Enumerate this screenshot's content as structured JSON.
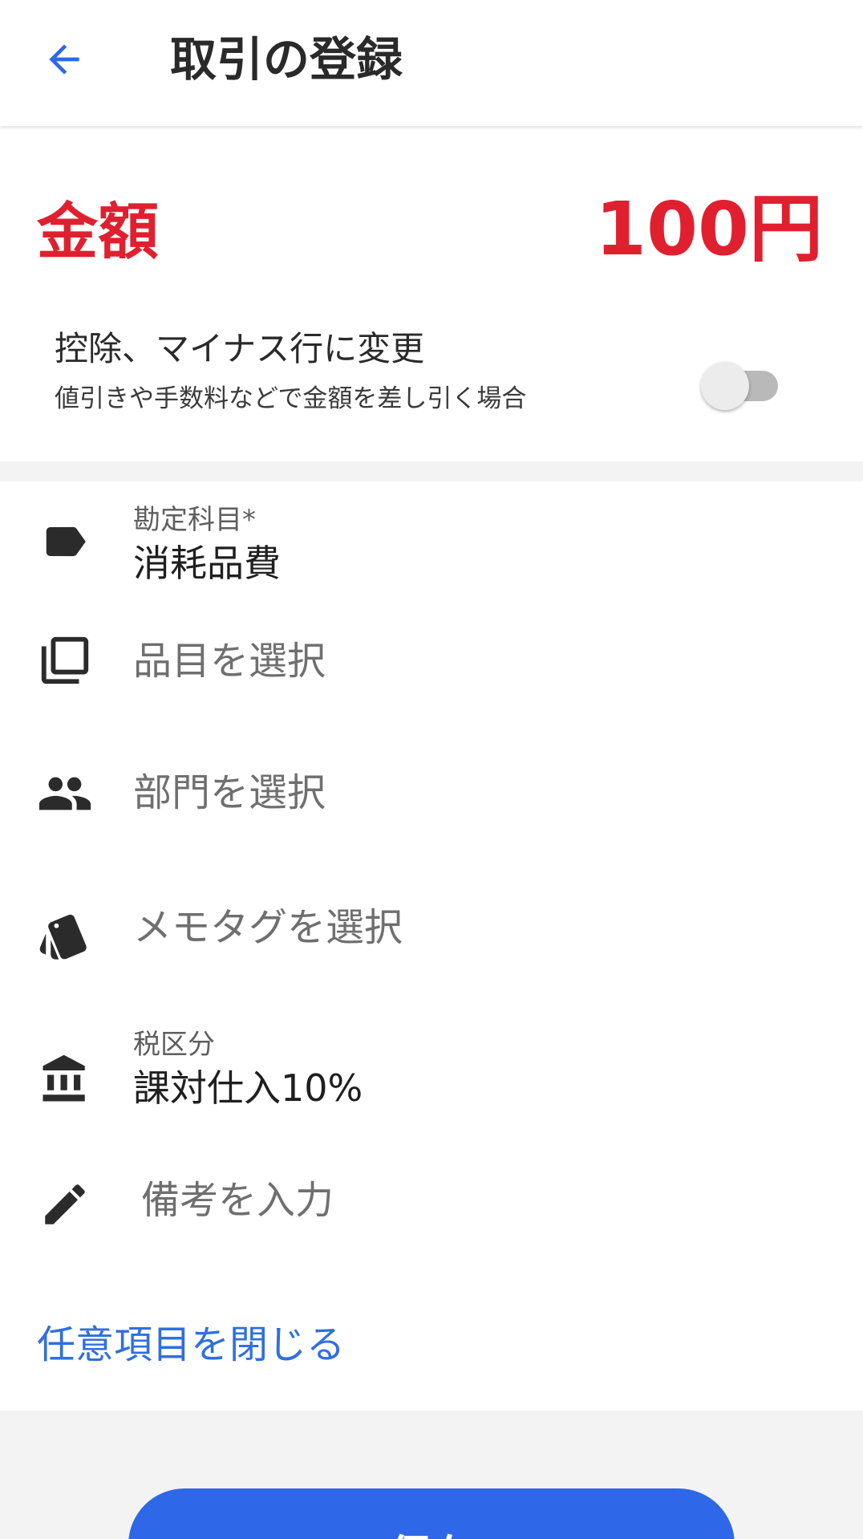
{
  "colors": {
    "accent_red": "#e0202f",
    "primary_blue": "#2e68e8",
    "link_blue": "#2f6fe0",
    "icon_dark": "#2b2b2b"
  },
  "header": {
    "back_icon": "arrow-left-icon",
    "title": "取引の登録"
  },
  "amount": {
    "label": "金額",
    "value": "100円"
  },
  "deduction": {
    "title": "控除、マイナス行に変更",
    "subtitle": "値引きや手数料などで金額を差し引く場合",
    "enabled": false
  },
  "form": {
    "account": {
      "icon": "label-tag-icon",
      "label": "勘定科目*",
      "value": "消耗品費"
    },
    "item": {
      "icon": "library-copy-icon",
      "placeholder": "品目を選択"
    },
    "department": {
      "icon": "people-icon",
      "placeholder": "部門を選択"
    },
    "memo_tag": {
      "icon": "tags-icon",
      "placeholder": "メモタグを選択"
    },
    "tax": {
      "icon": "bank-icon",
      "label": "税区分",
      "value": "課対仕入10%"
    },
    "note": {
      "icon": "pencil-icon",
      "placeholder": "備考を入力"
    },
    "collapse_link": "任意項目を閉じる"
  },
  "save_button": {
    "label": "保存"
  }
}
